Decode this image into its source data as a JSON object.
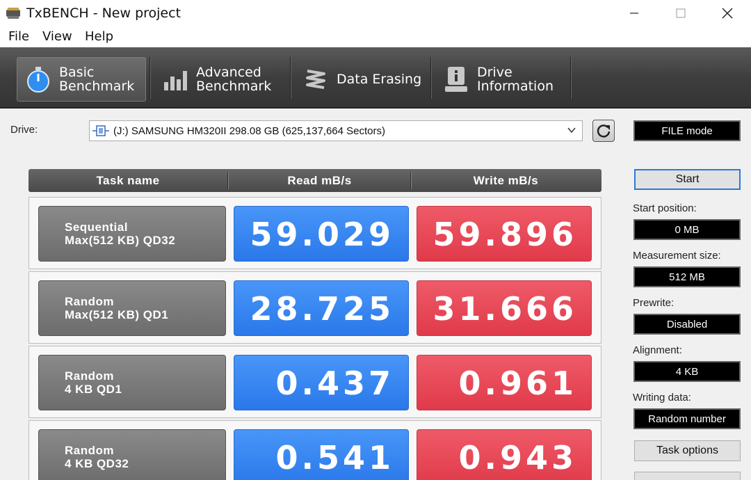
{
  "window": {
    "title": "TxBENCH - New project",
    "min_icon": "minimize-icon",
    "max_icon": "maximize-icon",
    "close_icon": "close-icon"
  },
  "menu": [
    "File",
    "View",
    "Help"
  ],
  "tabs": [
    {
      "label": "Basic\nBenchmark",
      "icon": "stopwatch-icon",
      "active": true
    },
    {
      "label": "Advanced\nBenchmark",
      "icon": "bar-chart-icon",
      "active": false
    },
    {
      "label": "Data Erasing",
      "icon": "spring-icon",
      "active": false
    },
    {
      "label": "Drive\nInformation",
      "icon": "drive-info-icon",
      "active": false
    }
  ],
  "drive": {
    "label": "Drive:",
    "selected": "(J:) SAMSUNG HM320II  298.08 GB (625,137,664 Sectors)"
  },
  "table": {
    "headers": [
      "Task name",
      "Read mB/s",
      "Write mB/s"
    ],
    "rows": [
      {
        "task": "Sequential\nMax(512 KB) QD32",
        "read": "59.029",
        "write": "59.896"
      },
      {
        "task": "Random\nMax(512 KB) QD1",
        "read": "28.725",
        "write": "31.666"
      },
      {
        "task": "Random\n4 KB QD1",
        "read": "0.437",
        "write": "0.961"
      },
      {
        "task": "Random\n4 KB QD32",
        "read": "0.541",
        "write": "0.943"
      }
    ]
  },
  "panel": {
    "mode": "FILE mode",
    "start": "Start",
    "start_position_label": "Start position:",
    "start_position": "0 MB",
    "measurement_size_label": "Measurement size:",
    "measurement_size": "512 MB",
    "prewrite_label": "Prewrite:",
    "prewrite": "Disabled",
    "alignment_label": "Alignment:",
    "alignment": "4 KB",
    "writing_data_label": "Writing data:",
    "writing_data": "Random number",
    "task_options": "Task options"
  },
  "colors": {
    "read": "#3a88f2",
    "write": "#e84a58",
    "toolbar": "#3e3e3e"
  }
}
